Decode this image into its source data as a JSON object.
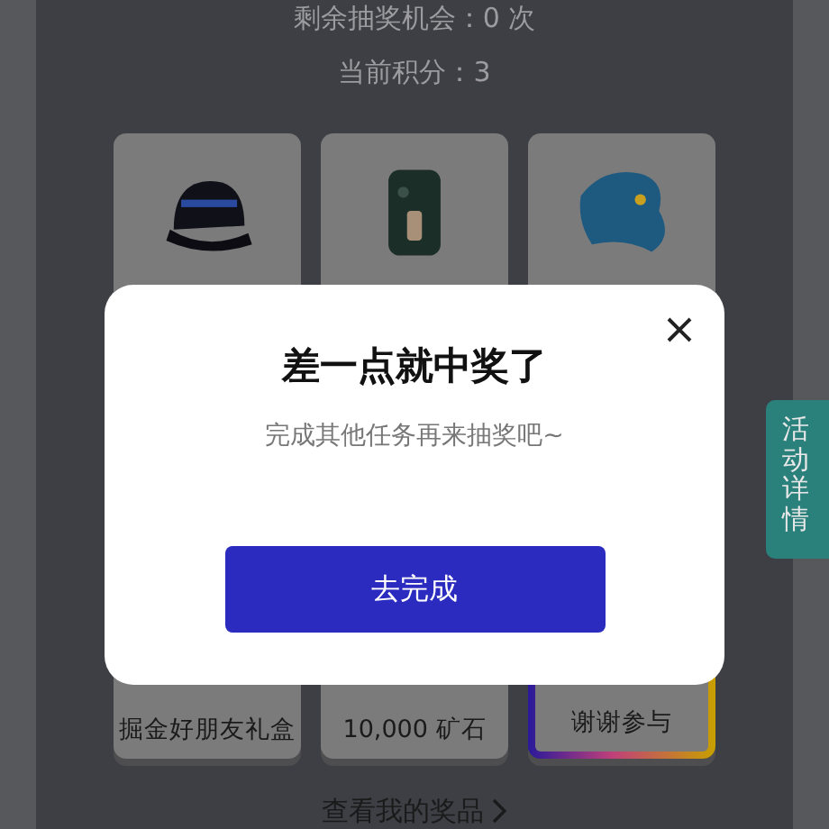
{
  "stats": [
    "剩余抽奖机会：0 次",
    "当前积分：3"
  ],
  "prize_rows": [
    [
      {
        "kind": "picture",
        "selected": false
      },
      {
        "kind": "picture",
        "selected": false
      },
      {
        "kind": "picture",
        "selected": false
      }
    ],
    [],
    [
      {
        "kind": "label",
        "label": "掘金好朋友礼盒",
        "selected": false
      },
      {
        "kind": "label",
        "label": "10,000 矿石",
        "selected": false
      },
      {
        "kind": "label",
        "label": "谢谢参与",
        "selected": true
      }
    ]
  ],
  "my_prizes_link": "查看我的奖品",
  "side_tab": "活动详情",
  "dialog": {
    "title": "差一点就中奖了",
    "message": "完成其他任务再来抽奖吧~",
    "button": "去完成"
  }
}
